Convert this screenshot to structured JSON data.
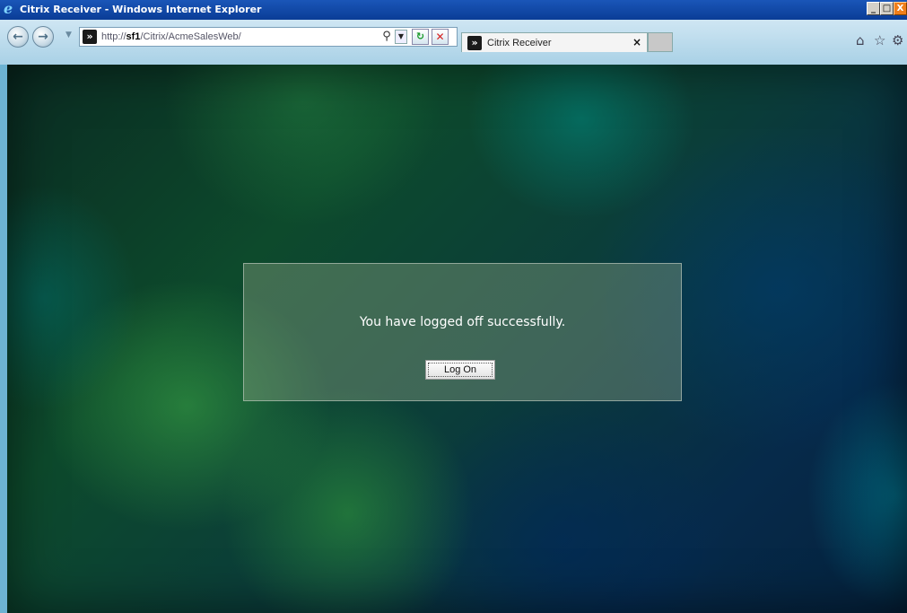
{
  "window": {
    "title": "Citrix Receiver - Windows Internet Explorer",
    "controls": {
      "minimize": "_",
      "maximize": "□",
      "close": "X"
    }
  },
  "navigation": {
    "back_icon": "back-arrow-icon",
    "forward_icon": "forward-arrow-icon",
    "address": {
      "url_prefix": "http://",
      "url_host": "sf1",
      "url_path": "/Citrix/AcmeSalesWeb/"
    },
    "search_icon": "search-icon",
    "refresh_icon": "refresh-icon",
    "stop_icon": "stop-icon"
  },
  "tabs": [
    {
      "label": "Citrix Receiver",
      "close": "×"
    }
  ],
  "toolbar_icons": [
    "home-icon",
    "star-icon",
    "gear-icon"
  ],
  "main": {
    "message": "You have logged off successfully.",
    "logon_button": "Log On"
  },
  "colors": {
    "titlebar": "#0a3c96",
    "close_button": "#f07e1a",
    "panel": "#96aa8c"
  }
}
